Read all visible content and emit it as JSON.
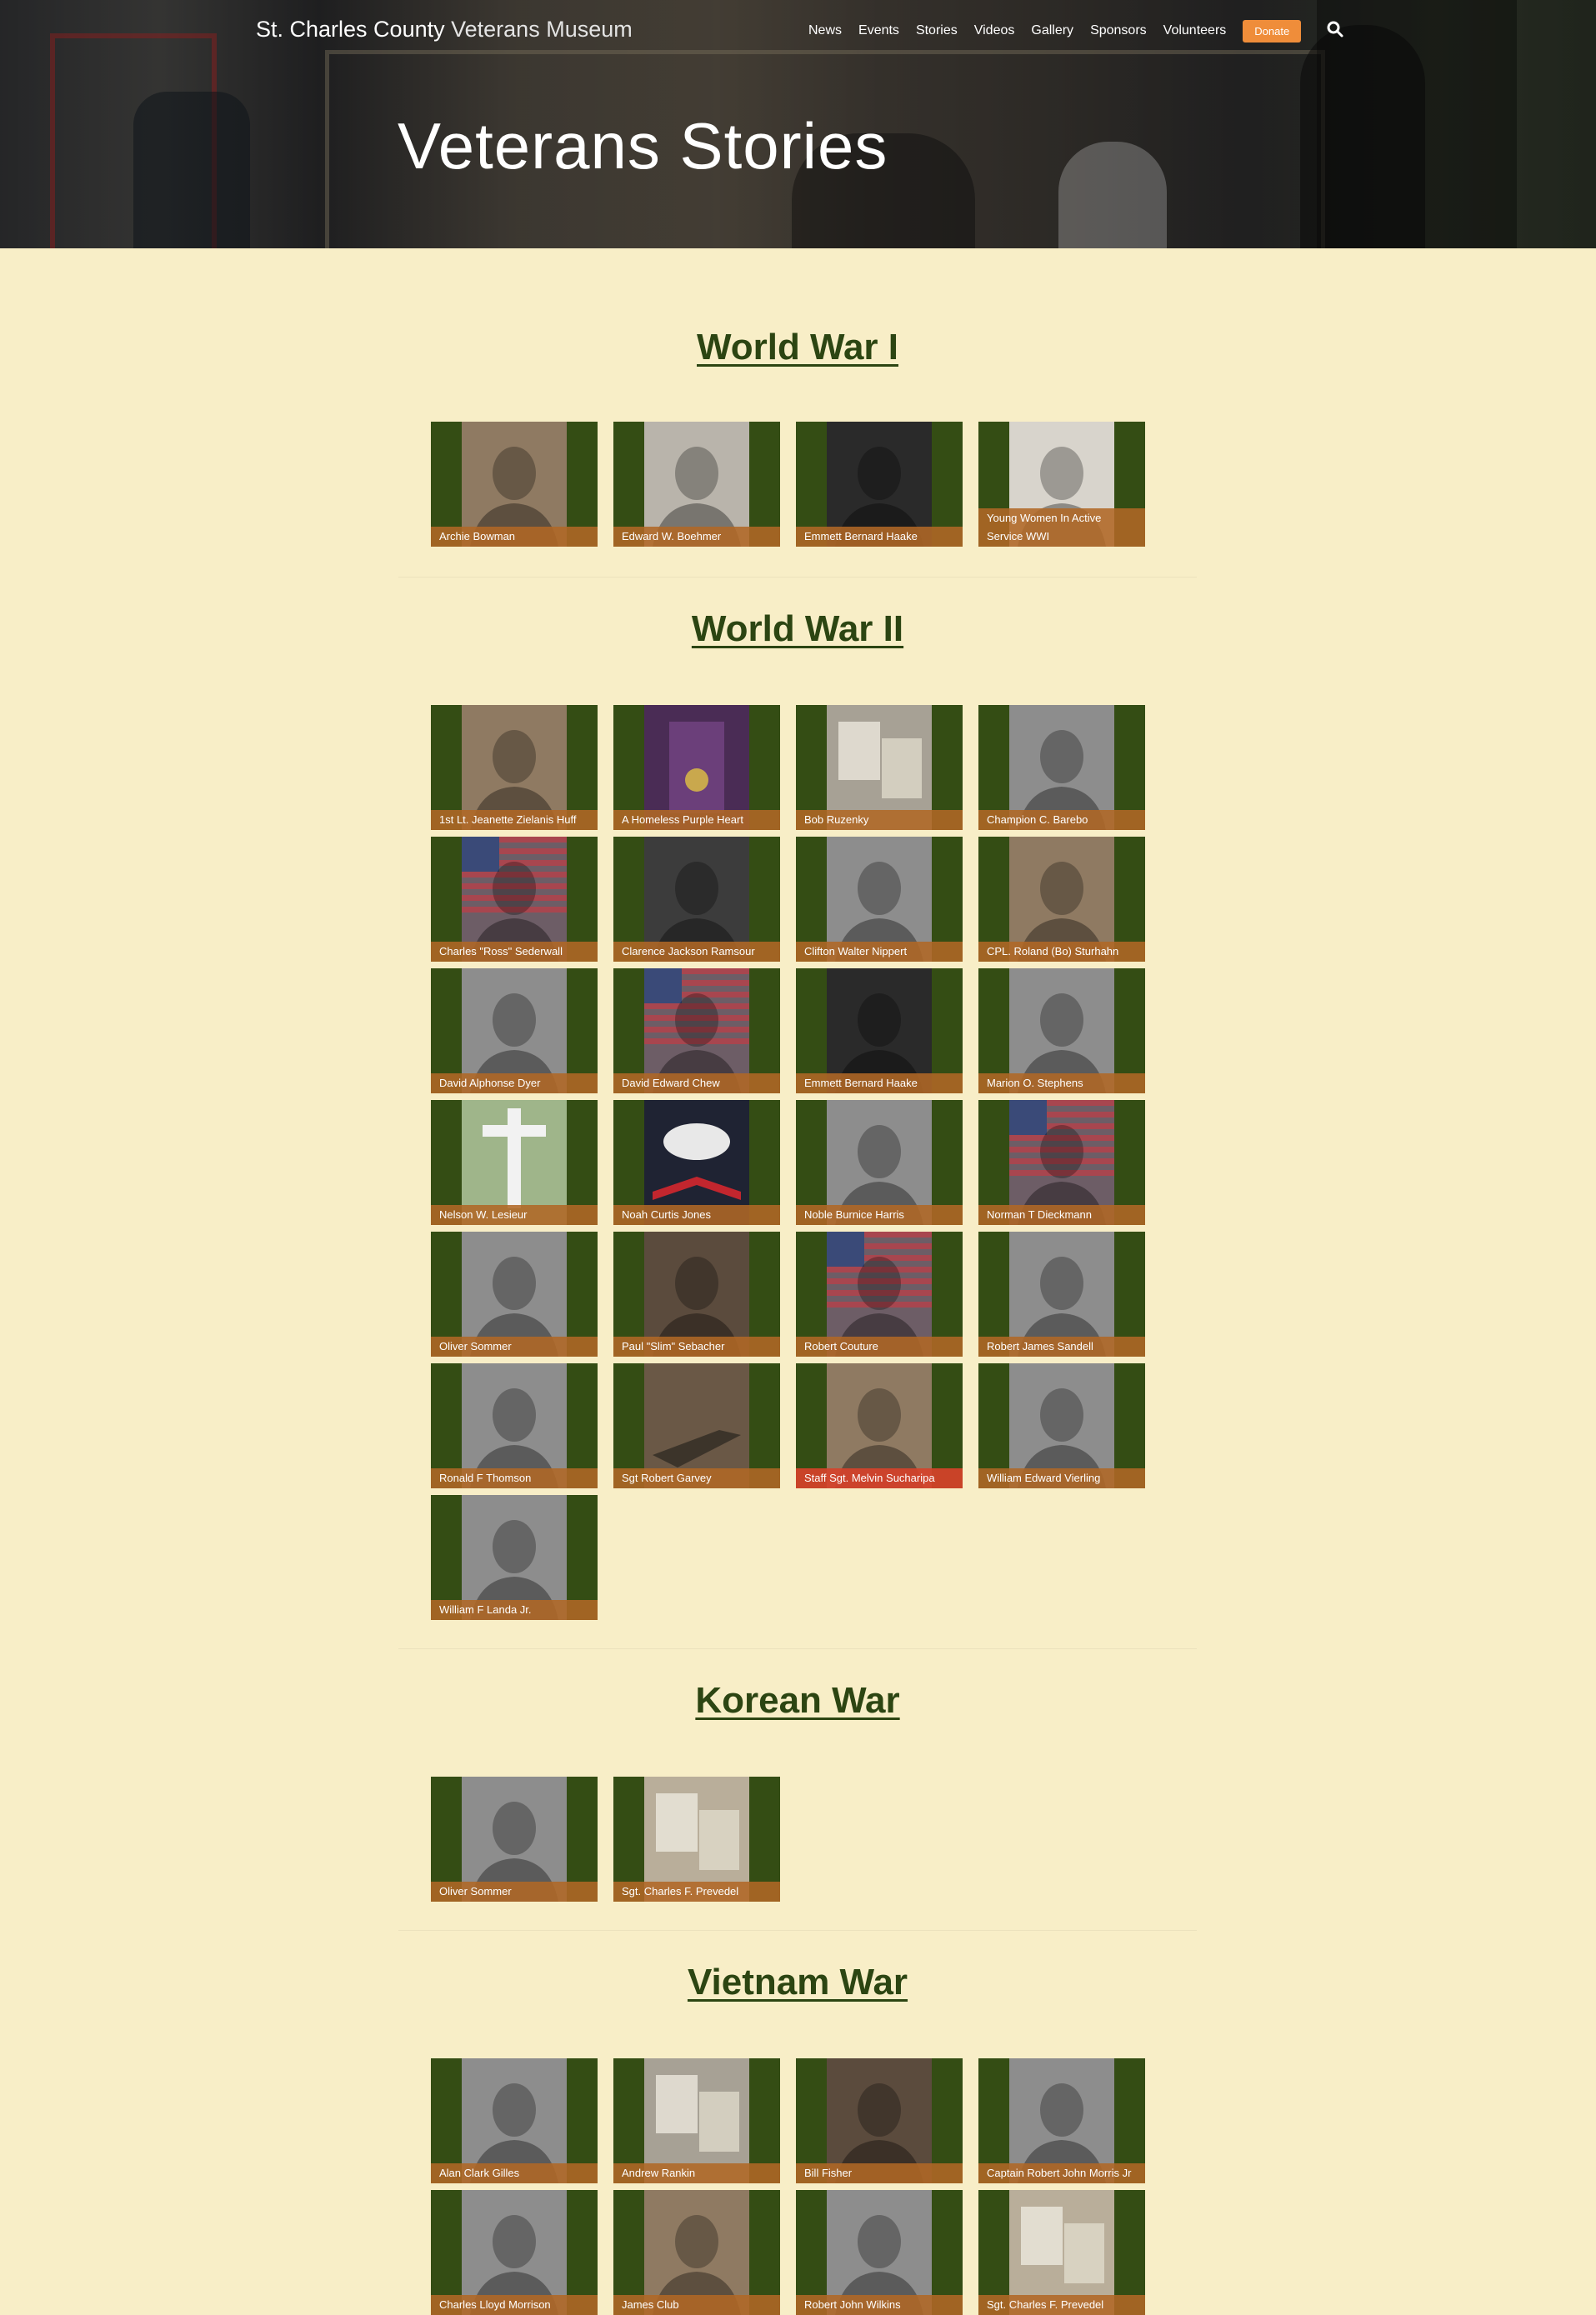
{
  "header": {
    "brand_strong": "St. Charles County",
    "brand_light": "Veterans Museum",
    "nav": [
      "News",
      "Events",
      "Stories",
      "Videos",
      "Gallery",
      "Sponsors",
      "Volunteers"
    ],
    "donate": "Donate",
    "hero_title": "Veterans Stories"
  },
  "sections": [
    {
      "title": "World War I",
      "cards": [
        {
          "label": "Archie Bowman",
          "tone": "sepia"
        },
        {
          "label": "Edward W. Boehmer",
          "tone": "oval"
        },
        {
          "label": "Emmett Bernard Haake",
          "tone": "navy"
        },
        {
          "label": "Young Women In Active Service WWI",
          "tone": "nurses"
        }
      ]
    },
    {
      "title": "World War II",
      "cards": [
        {
          "label": "1st Lt. Jeanette Zielanis Huff",
          "tone": "sepia"
        },
        {
          "label": "A Homeless Purple Heart",
          "tone": "purple"
        },
        {
          "label": "Bob Ruzenky",
          "tone": "docs"
        },
        {
          "label": "Champion C. Barebo",
          "tone": "bw"
        },
        {
          "label": "Charles \"Ross\" Sederwall",
          "tone": "flag"
        },
        {
          "label": "Clarence Jackson Ramsour",
          "tone": "dark"
        },
        {
          "label": "Clifton Walter Nippert",
          "tone": "bw"
        },
        {
          "label": "CPL. Roland (Bo) Sturhahn",
          "tone": "sepia"
        },
        {
          "label": "David Alphonse Dyer",
          "tone": "bw"
        },
        {
          "label": "David Edward Chew",
          "tone": "flag"
        },
        {
          "label": "Emmett Bernard Haake",
          "tone": "navy"
        },
        {
          "label": "Marion O. Stephens",
          "tone": "bw"
        },
        {
          "label": "Nelson W. Lesieur",
          "tone": "cross"
        },
        {
          "label": "Noah Curtis Jones",
          "tone": "eagle"
        },
        {
          "label": "Noble Burnice Harris",
          "tone": "bw"
        },
        {
          "label": "Norman T Dieckmann",
          "tone": "flag"
        },
        {
          "label": "Oliver Sommer",
          "tone": "bw"
        },
        {
          "label": "Paul \"Slim\" Sebacher",
          "tone": "room"
        },
        {
          "label": "Robert Couture",
          "tone": "flag"
        },
        {
          "label": "Robert James Sandell",
          "tone": "bw"
        },
        {
          "label": "Ronald F Thomson",
          "tone": "bw"
        },
        {
          "label": "Sgt Robert Garvey",
          "tone": "objects"
        },
        {
          "label": "Staff Sgt. Melvin Sucharipa",
          "tone": "sepia",
          "alt": true
        },
        {
          "label": "William Edward Vierling",
          "tone": "bw"
        },
        {
          "label": "William F Landa Jr.",
          "tone": "bw"
        }
      ]
    },
    {
      "title": "Korean War",
      "cards": [
        {
          "label": "Oliver Sommer",
          "tone": "bw"
        },
        {
          "label": "Sgt. Charles F. Prevedel",
          "tone": "news"
        }
      ]
    },
    {
      "title": "Vietnam War",
      "cards": [
        {
          "label": "Alan Clark Gilles",
          "tone": "bw"
        },
        {
          "label": "Andrew Rankin",
          "tone": "docs"
        },
        {
          "label": "Bill Fisher",
          "tone": "room"
        },
        {
          "label": "Captain Robert John Morris Jr",
          "tone": "bw"
        },
        {
          "label": "Charles Lloyd Morrison",
          "tone": "bw"
        },
        {
          "label": "James Club",
          "tone": "sepia"
        },
        {
          "label": "Robert John Wilkins",
          "tone": "bw"
        },
        {
          "label": "Sgt. Charles F. Prevedel",
          "tone": "news"
        }
      ]
    }
  ],
  "tones": {
    "sepia": "#8f7a62",
    "oval": "#b9b4ab",
    "navy": "#2a2a2a",
    "nurses": "#d8d4cc",
    "purple": "#4a2c55",
    "docs": "#a7a195",
    "bw": "#8d8d8d",
    "flag": "#6d5d66",
    "dark": "#3c3c3c",
    "cross": "#9fb58a",
    "eagle": "#1f2333",
    "room": "#5b4b3d",
    "objects": "#6a5846",
    "news": "#b9ae9a"
  }
}
